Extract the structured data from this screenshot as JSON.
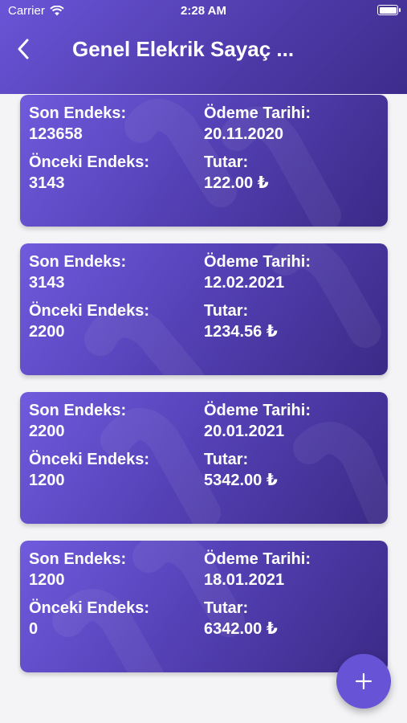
{
  "status_bar": {
    "carrier": "Carrier",
    "time": "2:28 AM"
  },
  "header": {
    "title": "Genel Elekrik Sayaç ..."
  },
  "labels": {
    "current_index": "Son Endeks:",
    "previous_index": "Önceki Endeks:",
    "payment_date": "Ödeme Tarihi:",
    "amount": "Tutar:"
  },
  "records": [
    {
      "current_index": "123658",
      "previous_index": "3143",
      "payment_date": "20.11.2020",
      "amount": "122.00 ₺"
    },
    {
      "current_index": "3143",
      "previous_index": "2200",
      "payment_date": "12.02.2021",
      "amount": "1234.56 ₺"
    },
    {
      "current_index": "2200",
      "previous_index": "1200",
      "payment_date": "20.01.2021",
      "amount": "5342.00 ₺"
    },
    {
      "current_index": "1200",
      "previous_index": "0",
      "payment_date": "18.01.2021",
      "amount": "6342.00 ₺"
    }
  ],
  "colors": {
    "header": "#5a46c4",
    "card": "#5642b8",
    "fab": "#6653d6",
    "background": "#f4f4f6"
  },
  "icons": {
    "back": "chevron-left-icon",
    "add": "plus-icon",
    "wifi": "wifi-icon",
    "battery": "battery-icon"
  }
}
